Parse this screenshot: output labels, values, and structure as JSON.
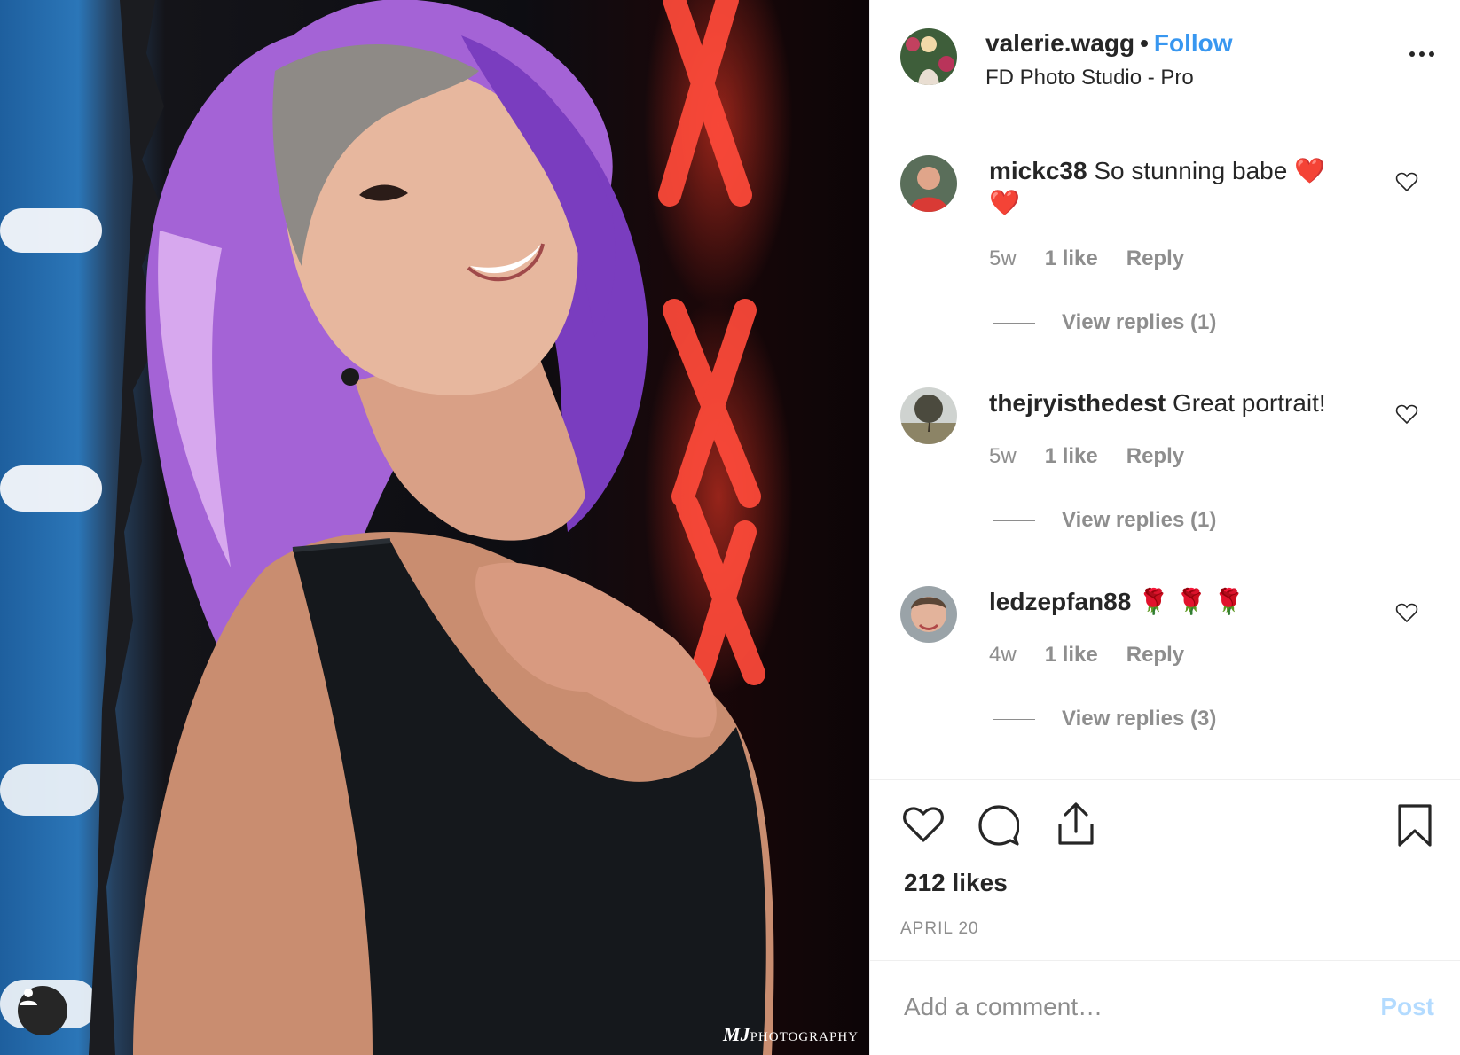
{
  "photo": {
    "description_alt": "",
    "watermark_mark": "MJ",
    "watermark_text": "PHOTOGRAPHY"
  },
  "header": {
    "username": "valerie.wagg",
    "separator": "•",
    "follow_label": "Follow",
    "location": "FD Photo Studio - Pro",
    "more_icon": "more-horizontal-icon"
  },
  "comments": [
    {
      "username": "mickc38",
      "text": "So stunning babe ❤️ ❤️",
      "age": "5w",
      "likes": "1 like",
      "reply_label": "Reply",
      "view_replies": "View replies (1)"
    },
    {
      "username": "thejryisthedest",
      "text": "Great portrait!",
      "age": "5w",
      "likes": "1 like",
      "reply_label": "Reply",
      "view_replies": "View replies (1)"
    },
    {
      "username": "ledzepfan88",
      "text": "🌹 🌹 🌹",
      "age": "4w",
      "likes": "1 like",
      "reply_label": "Reply",
      "view_replies": "View replies (3)"
    }
  ],
  "actions": {
    "like_icon": "heart-icon",
    "comment_icon": "comment-bubble-icon",
    "share_icon": "share-upload-icon",
    "save_icon": "bookmark-icon"
  },
  "likes_text": "212 likes",
  "date_text": "APRIL 20",
  "add_comment": {
    "placeholder": "Add a comment…",
    "post_label": "Post"
  },
  "colors": {
    "link_blue": "#3897f0",
    "post_disabled": "#b3dbff",
    "text_primary": "#262626",
    "text_secondary": "#8e8e8e",
    "divider": "#efefef"
  }
}
